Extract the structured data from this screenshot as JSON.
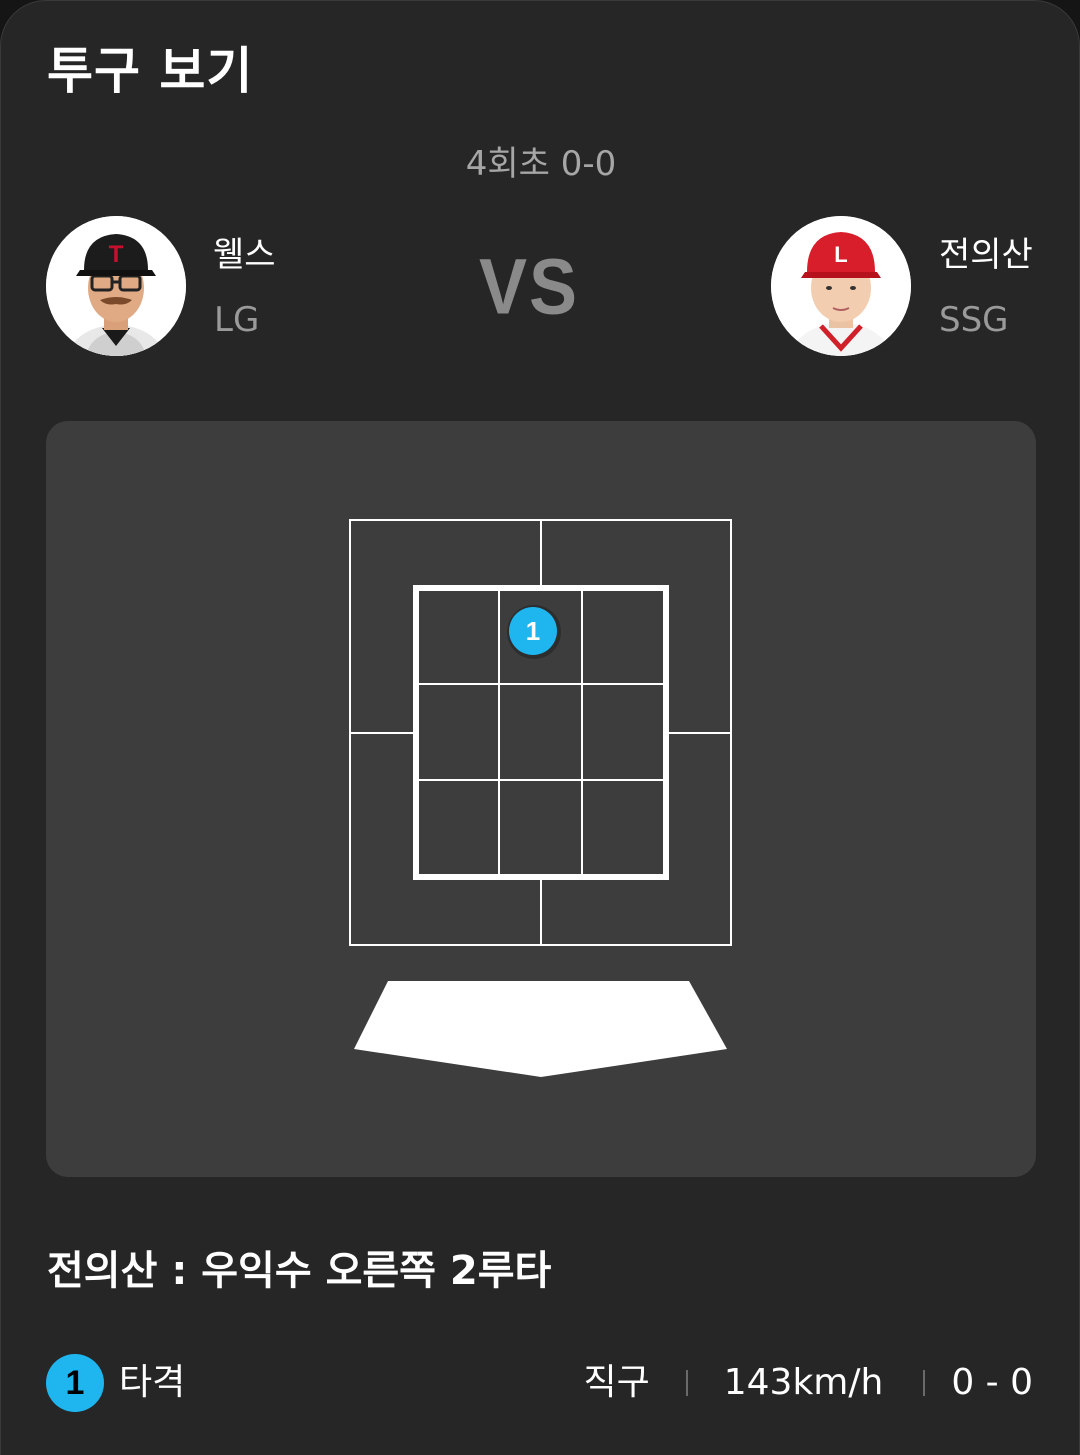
{
  "header": {
    "title": "투구 보기"
  },
  "game": {
    "inning_score": "4회초 0-0",
    "vs_label": "VS"
  },
  "pitcher": {
    "name": "웰스",
    "team": "LG",
    "avatar_icon": "player-photo-icon"
  },
  "batter": {
    "name": "전의산",
    "team": "SSG",
    "avatar_icon": "player-photo-icon"
  },
  "strike_zone": {
    "pitches": [
      {
        "number": "1",
        "color": "#1fb6f0"
      }
    ]
  },
  "result": {
    "text": "전의산 : 우익수 오른쪽 2루타"
  },
  "pitch_detail": {
    "number": "1",
    "event": "타격",
    "pitch_type": "직구",
    "speed": "143km/h",
    "count": "0 - 0"
  },
  "colors": {
    "background": "#262626",
    "panel": "#3d3d3d",
    "accent": "#1fb6f0",
    "muted_text": "#9a9a9a"
  }
}
